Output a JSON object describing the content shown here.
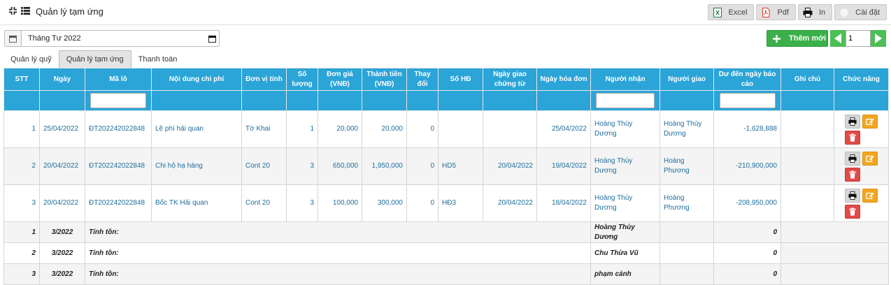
{
  "header": {
    "title": "Quản lý tạm ứng",
    "toolbar": {
      "excel": "Excel",
      "pdf": "Pdf",
      "print": "In",
      "settings": "Cài đặt"
    }
  },
  "filter": {
    "month": "Tháng Tư 2022"
  },
  "actions": {
    "add_label": "Thêm mới",
    "page": "1"
  },
  "tabs": [
    {
      "label": "Quản lý quỹ"
    },
    {
      "label": "Quản lý tạm ứng",
      "active": true
    },
    {
      "label": "Thanh toán"
    }
  ],
  "table": {
    "columns": [
      "STT",
      "Ngày",
      "Mã lô",
      "Nội dung chi phí",
      "Đơn vị tính",
      "Số lượng",
      "Đơn giá (VNĐ)",
      "Thành tiền (VNĐ)",
      "Thay đổi",
      "Số HĐ",
      "Ngày giao chứng từ",
      "Ngày hóa đơn",
      "Người nhận",
      "Người giao",
      "Dư đến ngày báo cáo",
      "Ghi chú",
      "Chức năng"
    ],
    "rows": [
      {
        "stt": "1",
        "ngay": "25/04/2022",
        "ma_lo": "ĐT202242022848",
        "noi_dung": "Lệ phí hải quan",
        "dvt": "Tờ Khai",
        "so_luong": "1",
        "don_gia": "20,000",
        "thanh_tien": "20,000",
        "thay_doi": "0",
        "so_hd": "",
        "ngay_giao": "",
        "ngay_hd": "25/04/2022",
        "nguoi_nhan": "Hoàng Thùy Dương",
        "nguoi_giao": "Hoàng Thùy Dương",
        "du": "-1,628,888",
        "ghi_chu": ""
      },
      {
        "stt": "2",
        "ngay": "20/04/2022",
        "ma_lo": "ĐT202242022848",
        "noi_dung": "Chi hộ hạ hàng",
        "dvt": "Cont 20",
        "so_luong": "3",
        "don_gia": "650,000",
        "thanh_tien": "1,950,000",
        "thay_doi": "0",
        "so_hd": "HD5",
        "ngay_giao": "20/04/2022",
        "ngay_hd": "19/04/2022",
        "nguoi_nhan": "Hoàng Thùy Dương",
        "nguoi_giao": "Hoàng Phương",
        "du": "-210,900,000",
        "ghi_chu": ""
      },
      {
        "stt": "3",
        "ngay": "20/04/2022",
        "ma_lo": "ĐT202242022848",
        "noi_dung": "Bốc TK Hải quan",
        "dvt": "Cont 20",
        "so_luong": "3",
        "don_gia": "100,000",
        "thanh_tien": "300,000",
        "thay_doi": "0",
        "so_hd": "HĐ3",
        "ngay_giao": "20/04/2022",
        "ngay_hd": "18/04/2022",
        "nguoi_nhan": "Hoàng Thùy Dương",
        "nguoi_giao": "Hoàng Phương",
        "du": "-208,950,000",
        "ghi_chu": ""
      }
    ],
    "summary": [
      {
        "stt": "1",
        "month": "3/2022",
        "label": "Tính tồn:",
        "person": "Hoàng Thùy Dương",
        "value": "0"
      },
      {
        "stt": "2",
        "month": "3/2022",
        "label": "Tính tồn:",
        "person": "Chu Thừa Vũ",
        "value": "0"
      },
      {
        "stt": "3",
        "month": "3/2022",
        "label": "Tính tồn:",
        "person": "phạm cảnh",
        "value": "0"
      }
    ]
  },
  "colors": {
    "header_blue": "#2ba4d8",
    "add_green": "#3bb04a",
    "edit_orange": "#f2a520",
    "delete_red": "#e04a48",
    "link_blue": "#1f6e9c"
  }
}
